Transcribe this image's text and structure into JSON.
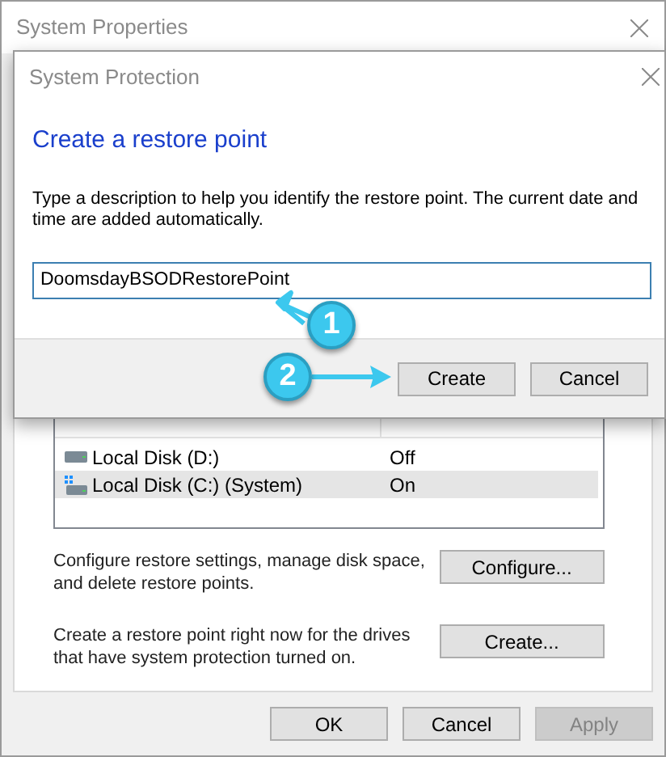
{
  "outer_window": {
    "title": "System Properties",
    "drives_list": {
      "rows": [
        {
          "name": "Local Disk (D:)",
          "protection": "Off",
          "kind": "data",
          "selected": false
        },
        {
          "name": "Local Disk (C:) (System)",
          "protection": "On",
          "kind": "system",
          "selected": true
        }
      ]
    },
    "actions": [
      {
        "text": "Configure restore settings, manage disk space, and delete restore points.",
        "button": "Configure..."
      },
      {
        "text": "Create a restore point right now for the drives that have system protection turned on.",
        "button": "Create..."
      }
    ],
    "buttons": [
      {
        "label": "OK",
        "disabled": false
      },
      {
        "label": "Cancel",
        "disabled": false
      },
      {
        "label": "Apply",
        "disabled": true
      }
    ]
  },
  "dialog": {
    "title": "System Protection",
    "heading": "Create a restore point",
    "description": "Type a description to help you identify the restore point. The current date and time are added automatically.",
    "input_value": "DoomsdayBSODRestorePoint",
    "buttons": [
      {
        "label": "Create"
      },
      {
        "label": "Cancel"
      }
    ]
  },
  "callouts": [
    {
      "number": "1"
    },
    {
      "number": "2"
    }
  ]
}
